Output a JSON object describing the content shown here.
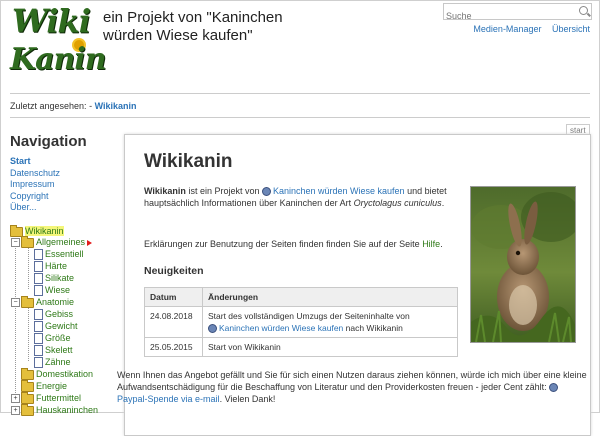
{
  "header": {
    "logo_line1": "Wiki",
    "logo_line2": "Kanin",
    "tagline_line1": "ein Projekt von \"Kaninchen",
    "tagline_line2": "würden Wiese kaufen\"",
    "search_placeholder": "Suche",
    "links": [
      "Medien-Manager",
      "Übersicht"
    ]
  },
  "breadcrumb": {
    "label": "Zuletzt angesehen:",
    "separator": "-",
    "current": "Wikikanin"
  },
  "sidebar": {
    "title": "Navigation",
    "links": [
      "Start",
      "Datenschutz",
      "Impressum",
      "Copyright",
      "Über..."
    ],
    "tree": [
      {
        "label": "Wikikanin",
        "type": "folder",
        "level": 0
      },
      {
        "label": "Allgemeines",
        "type": "folder",
        "level": 1,
        "expanded": true
      },
      {
        "label": "Essentiell",
        "type": "page",
        "level": 2
      },
      {
        "label": "Härte",
        "type": "page",
        "level": 2
      },
      {
        "label": "Silikate",
        "type": "page",
        "level": 2
      },
      {
        "label": "Wiese",
        "type": "page",
        "level": 2
      },
      {
        "label": "Anatomie",
        "type": "folder",
        "level": 1,
        "expanded": true
      },
      {
        "label": "Gebiss",
        "type": "page",
        "level": 2
      },
      {
        "label": "Gewicht",
        "type": "page",
        "level": 2
      },
      {
        "label": "Größe",
        "type": "page",
        "level": 2
      },
      {
        "label": "Skelett",
        "type": "page",
        "level": 2
      },
      {
        "label": "Zähne",
        "type": "page",
        "level": 2
      },
      {
        "label": "Domestikation",
        "type": "folder",
        "level": 1
      },
      {
        "label": "Energie",
        "type": "folder",
        "level": 1
      },
      {
        "label": "Futtermittel",
        "type": "folder",
        "level": 1
      },
      {
        "label": "Hauskaninchen",
        "type": "folder",
        "level": 1
      }
    ]
  },
  "content": {
    "tab": "start",
    "title": "Wikikanin",
    "intro_bold": "Wikikanin",
    "intro_1": " ist ein Projekt von ",
    "intro_link": "Kaninchen würden Wiese kaufen",
    "intro_2": " und bietet hauptsächlich Informationen über Kaninchen der Art ",
    "intro_species": "Oryctolagus cuniculus",
    "intro_3": ".",
    "help_text": "Erklärungen zur Benutzung der Seiten finden finden Sie auf der Seite ",
    "help_link": "Hilfe",
    "help_end": ".",
    "news_title": "Neuigkeiten",
    "table": {
      "headers": [
        "Datum",
        "Änderungen"
      ],
      "rows": [
        {
          "date": "24.08.2018",
          "text": "Start des vollständigen Umzugs der Seiteninhalte von ",
          "link": "Kaninchen würden Wiese kaufen",
          "text2": " nach Wikikanin"
        },
        {
          "date": "25.05.2015",
          "text": "Start von Wikikanin"
        }
      ]
    },
    "footer_1": "Wenn Ihnen das Angebot gefällt und Sie für sich einen Nutzen daraus ziehen können, würde ich mich über eine kleine Aufwandsentschädigung für die Beschaffung von Literatur und den Providerkosten freuen - jeder Cent zählt: ",
    "footer_link": "Paypal-Spende via e-mail",
    "footer_2": ". Vielen Dank!"
  },
  "colors": {
    "link": "#2b73b7",
    "tree_green": "#2f7a18",
    "logo_green": "#2f6b1f"
  }
}
